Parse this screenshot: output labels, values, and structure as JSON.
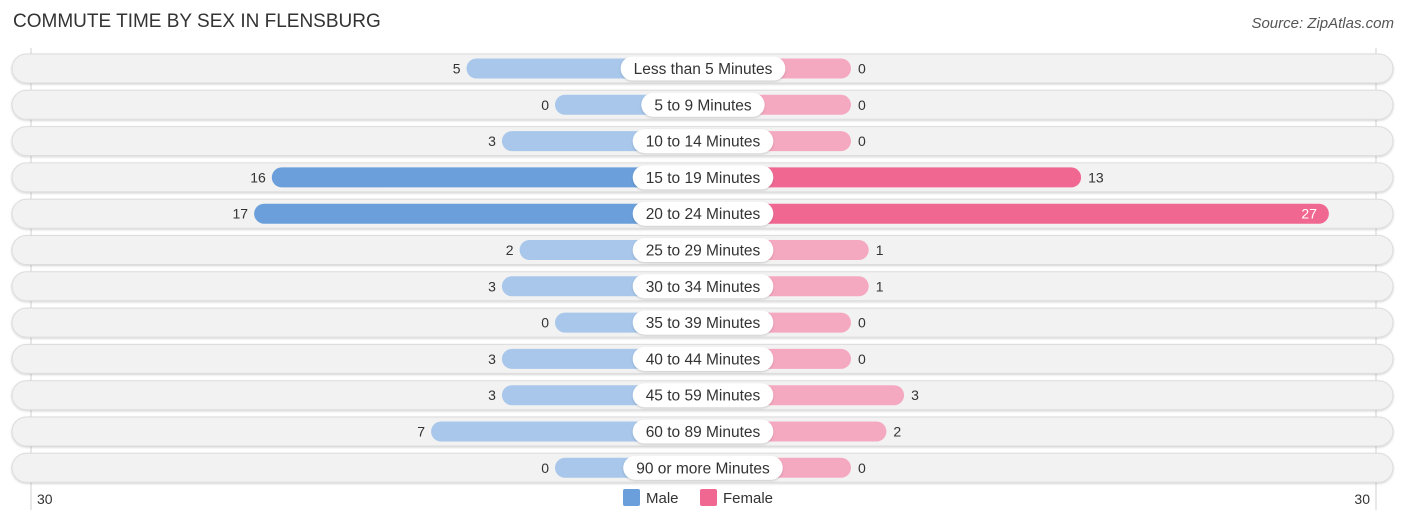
{
  "title": "COMMUTE TIME BY SEX IN FLENSBURG",
  "source": "Source: ZipAtlas.com",
  "colors": {
    "male": "#6a9fdb",
    "male_light": "#a8c7ea",
    "female": "#f06892",
    "female_light": "#f5a9c1",
    "track": "#f2f2f2"
  },
  "chart_data": {
    "type": "bar",
    "orientation": "horizontal-diverging",
    "title": "COMMUTE TIME BY SEX IN FLENSBURG",
    "categories": [
      "Less than 5 Minutes",
      "5 to 9 Minutes",
      "10 to 14 Minutes",
      "15 to 19 Minutes",
      "20 to 24 Minutes",
      "25 to 29 Minutes",
      "30 to 34 Minutes",
      "35 to 39 Minutes",
      "40 to 44 Minutes",
      "45 to 59 Minutes",
      "60 to 89 Minutes",
      "90 or more Minutes"
    ],
    "series": [
      {
        "name": "Male",
        "values": [
          5,
          0,
          3,
          16,
          17,
          2,
          3,
          0,
          3,
          3,
          7,
          0
        ]
      },
      {
        "name": "Female",
        "values": [
          0,
          0,
          0,
          13,
          27,
          1,
          1,
          0,
          0,
          3,
          2,
          0
        ]
      }
    ],
    "axis": {
      "left_label": "30",
      "right_label": "30",
      "max": 30
    },
    "legend": {
      "placement": "bottom-center",
      "entries": [
        "Male",
        "Female"
      ]
    }
  }
}
